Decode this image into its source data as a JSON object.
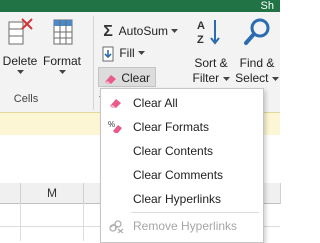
{
  "window": {
    "user_initial": "Sh"
  },
  "ribbon": {
    "cells_group": {
      "label": "Cells",
      "delete_label": "Delete",
      "format_label": "Format"
    },
    "editing_group": {
      "autosum_label": "AutoSum",
      "fill_label": "Fill",
      "clear_label": "Clear",
      "sort_filter_line1": "Sort &",
      "sort_filter_line2": "Filter",
      "find_select_line1": "Find &",
      "find_select_line2": "Select"
    }
  },
  "sheet": {
    "column_letter": "M"
  },
  "clear_menu": {
    "items": [
      {
        "label": "Clear All",
        "icon": "eraser-icon",
        "enabled": true
      },
      {
        "label": "Clear Formats",
        "icon": "clear-formats-icon",
        "enabled": true
      },
      {
        "label": "Clear Contents",
        "icon": "",
        "enabled": true
      },
      {
        "label": "Clear Comments",
        "icon": "",
        "enabled": true
      },
      {
        "label": "Clear Hyperlinks",
        "icon": "",
        "enabled": true
      },
      {
        "label": "Remove Hyperlinks",
        "icon": "remove-hyperlinks-icon",
        "enabled": false
      }
    ]
  },
  "colors": {
    "title_bar": "#217346",
    "ribbon_bg": "#f3f3f3",
    "eraser_pink": "#e85b8b",
    "formula_strip": "#fdf6d4"
  }
}
